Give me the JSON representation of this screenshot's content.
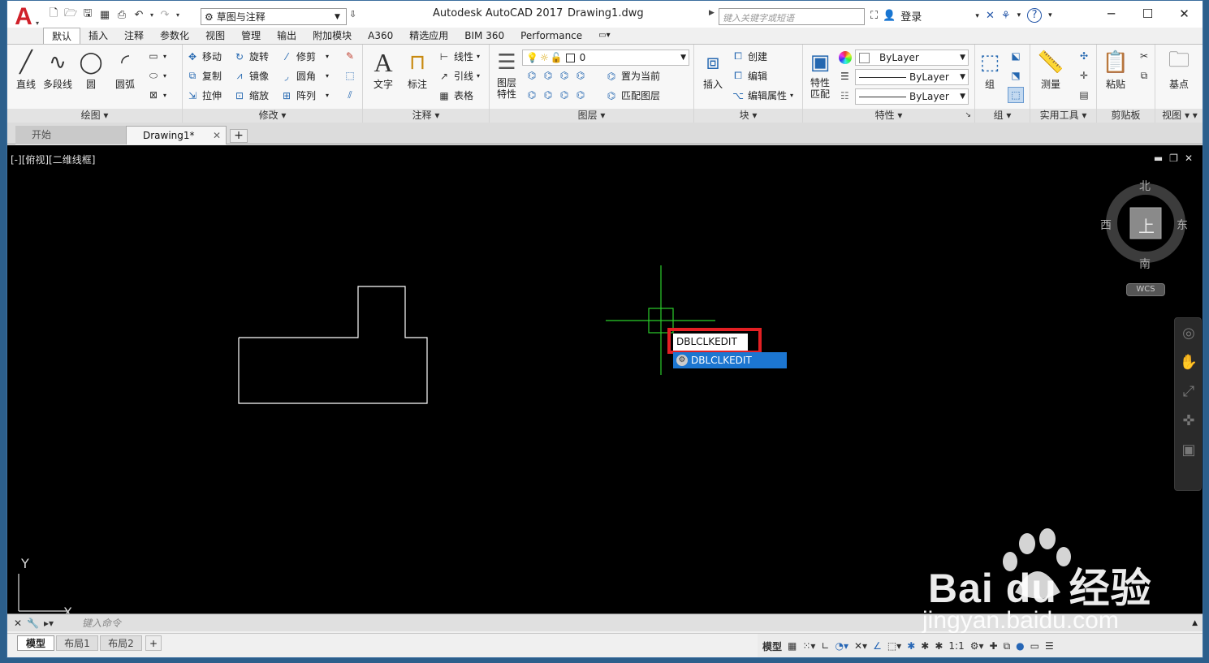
{
  "titlebar": {
    "app_title": "Autodesk AutoCAD 2017",
    "doc_title": "Drawing1.dwg",
    "workspace": "草图与注释",
    "search_placeholder": "键入关键字或短语",
    "login": "登录"
  },
  "ribbon_tabs": [
    "默认",
    "插入",
    "注释",
    "参数化",
    "视图",
    "管理",
    "输出",
    "附加模块",
    "A360",
    "精选应用",
    "BIM 360",
    "Performance"
  ],
  "panels": {
    "draw": {
      "title": "绘图",
      "line": "直线",
      "polyline": "多段线",
      "circle": "圆",
      "arc": "圆弧"
    },
    "modify": {
      "title": "修改",
      "move": "移动",
      "rotate": "旋转",
      "trim": "修剪",
      "copy": "复制",
      "mirror": "镜像",
      "fillet": "圆角",
      "stretch": "拉伸",
      "scale": "缩放",
      "array": "阵列"
    },
    "annotation": {
      "title": "注释",
      "text": "文字",
      "dimension": "标注",
      "linear": "线性",
      "leader": "引线",
      "table": "表格"
    },
    "layers": {
      "title": "图层",
      "layer_props": "图层\n特性",
      "layer_value": "0",
      "set_current": "置为当前",
      "match_layer": "匹配图层"
    },
    "block": {
      "title": "块",
      "insert": "插入",
      "create": "创建",
      "edit": "编辑",
      "edit_attr": "编辑属性"
    },
    "properties": {
      "title": "特性",
      "match": "特性\n匹配",
      "color": "ByLayer",
      "linetype": "ByLayer",
      "lineweight": "ByLayer"
    },
    "groups": {
      "title": "组",
      "group": "组"
    },
    "utilities": {
      "title": "实用工具",
      "measure": "测量"
    },
    "clipboard": {
      "title": "剪贴板",
      "paste": "粘贴"
    },
    "view": {
      "title": "视图",
      "base": "基点"
    }
  },
  "filetabs": {
    "start": "开始",
    "drawing": "Drawing1*"
  },
  "viewport": {
    "label": "[-][俯视][二维线框]",
    "north": "北",
    "south": "南",
    "east": "东",
    "west": "西",
    "top": "上",
    "wcs": "WCS",
    "axis_y": "Y",
    "axis_x": "X"
  },
  "autocomplete": {
    "typed": "DBLCLKEDIT",
    "suggestion": "DBLCLKEDIT"
  },
  "cmdline": {
    "placeholder": "键入命令"
  },
  "layout_tabs": [
    "模型",
    "布局1",
    "布局2"
  ],
  "status": {
    "model": "模型",
    "scale": "1:1"
  },
  "watermark": {
    "brand": "Bai du 经验",
    "url": "jingyan.baidu.com"
  }
}
